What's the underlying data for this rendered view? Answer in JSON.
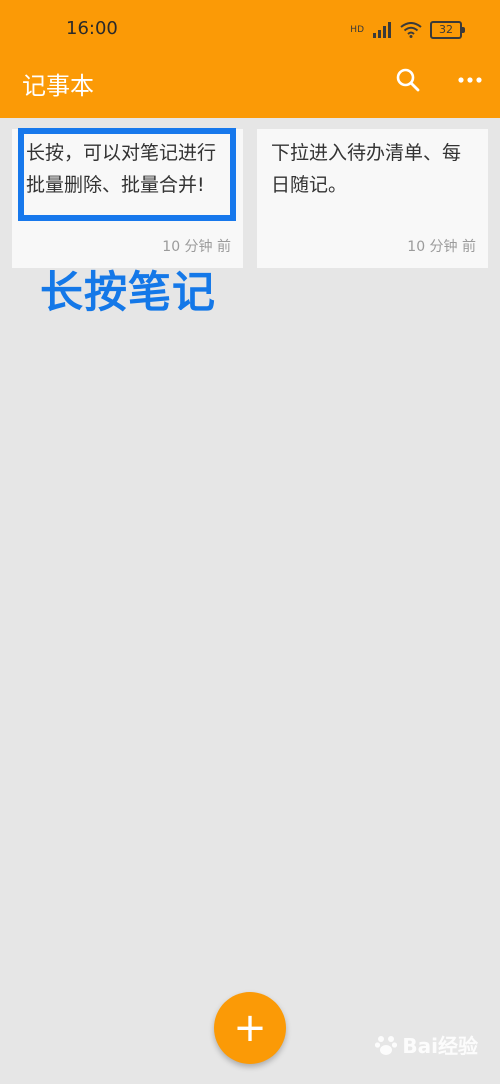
{
  "status_bar": {
    "time": "16:00",
    "hd_label": "HD",
    "battery": "32"
  },
  "app_bar": {
    "title": "记事本",
    "search_icon": "search-icon",
    "more_icon": "more-icon"
  },
  "notes": [
    {
      "text": "长按，可以对笔记进行批量删除、批量合并!",
      "time": "10 分钟 前"
    },
    {
      "text": "下拉进入待办清单、每日随记。",
      "time": "10 分钟 前"
    }
  ],
  "annotation": {
    "text": "长按笔记",
    "color": "#1478e8"
  },
  "fab": {
    "label": "+"
  },
  "watermark": {
    "text": "Bai经验"
  },
  "colors": {
    "accent": "#fb9a06",
    "background": "#e6e6e6",
    "highlight": "#1778ec"
  }
}
